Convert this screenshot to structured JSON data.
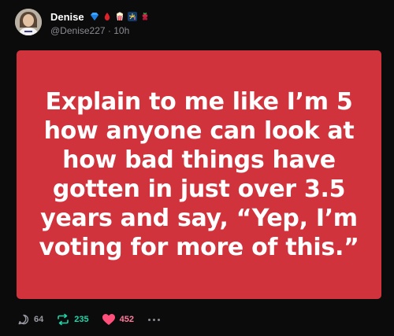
{
  "author": {
    "display_name": "Denise",
    "handle": "@Denise227",
    "separator": " · ",
    "time_ago": "10h",
    "badges": [
      "blue-diamond-icon",
      "red-drop-icon",
      "popcorn-icon",
      "fireworks-icon",
      "raspberry-icon"
    ]
  },
  "post": {
    "image_text": "Explain to me like I’m 5 how anyone can look at how bad things have gotten in just over 3.5 years and say, “Yep, I’m voting for more of this.”",
    "image_background": "#d1333d"
  },
  "actions": {
    "replies": "64",
    "reposts": "235",
    "likes": "452"
  },
  "colors": {
    "background": "#0b0b0c",
    "repost": "#1fd4a6",
    "like": "#ff4f7b"
  }
}
